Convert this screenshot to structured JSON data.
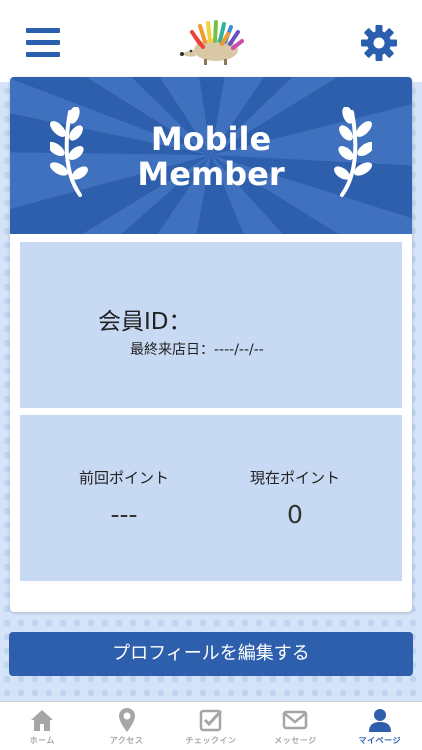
{
  "header": {
    "menu_icon": "hamburger-menu-icon",
    "logo_icon": "hedgehog-logo-icon",
    "settings_icon": "gear-icon"
  },
  "banner": {
    "title": "Mobile\nMember",
    "left_icon": "laurel-branch-icon",
    "right_icon": "laurel-branch-icon"
  },
  "member": {
    "id_label": "会員ID：",
    "id_value": "",
    "last_visit_label": "最終来店日：",
    "last_visit_value": "----/--/--"
  },
  "points": {
    "previous_label": "前回ポイント",
    "previous_value": "---",
    "current_label": "現在ポイント",
    "current_value": "0"
  },
  "profile_button": {
    "label": "プロフィールを編集する"
  },
  "tabs": [
    {
      "label": "ホーム",
      "icon": "home-icon",
      "active": false
    },
    {
      "label": "アクセス",
      "icon": "map-pin-icon",
      "active": false
    },
    {
      "label": "チェックイン",
      "icon": "checkin-icon",
      "active": false
    },
    {
      "label": "メッセージ",
      "icon": "envelope-icon",
      "active": false
    },
    {
      "label": "マイページ",
      "icon": "user-icon",
      "active": true
    }
  ],
  "colors": {
    "brand_blue": "#2d5fad",
    "panel_blue": "#c8daf3",
    "tab_inactive": "#a6a6a6"
  }
}
